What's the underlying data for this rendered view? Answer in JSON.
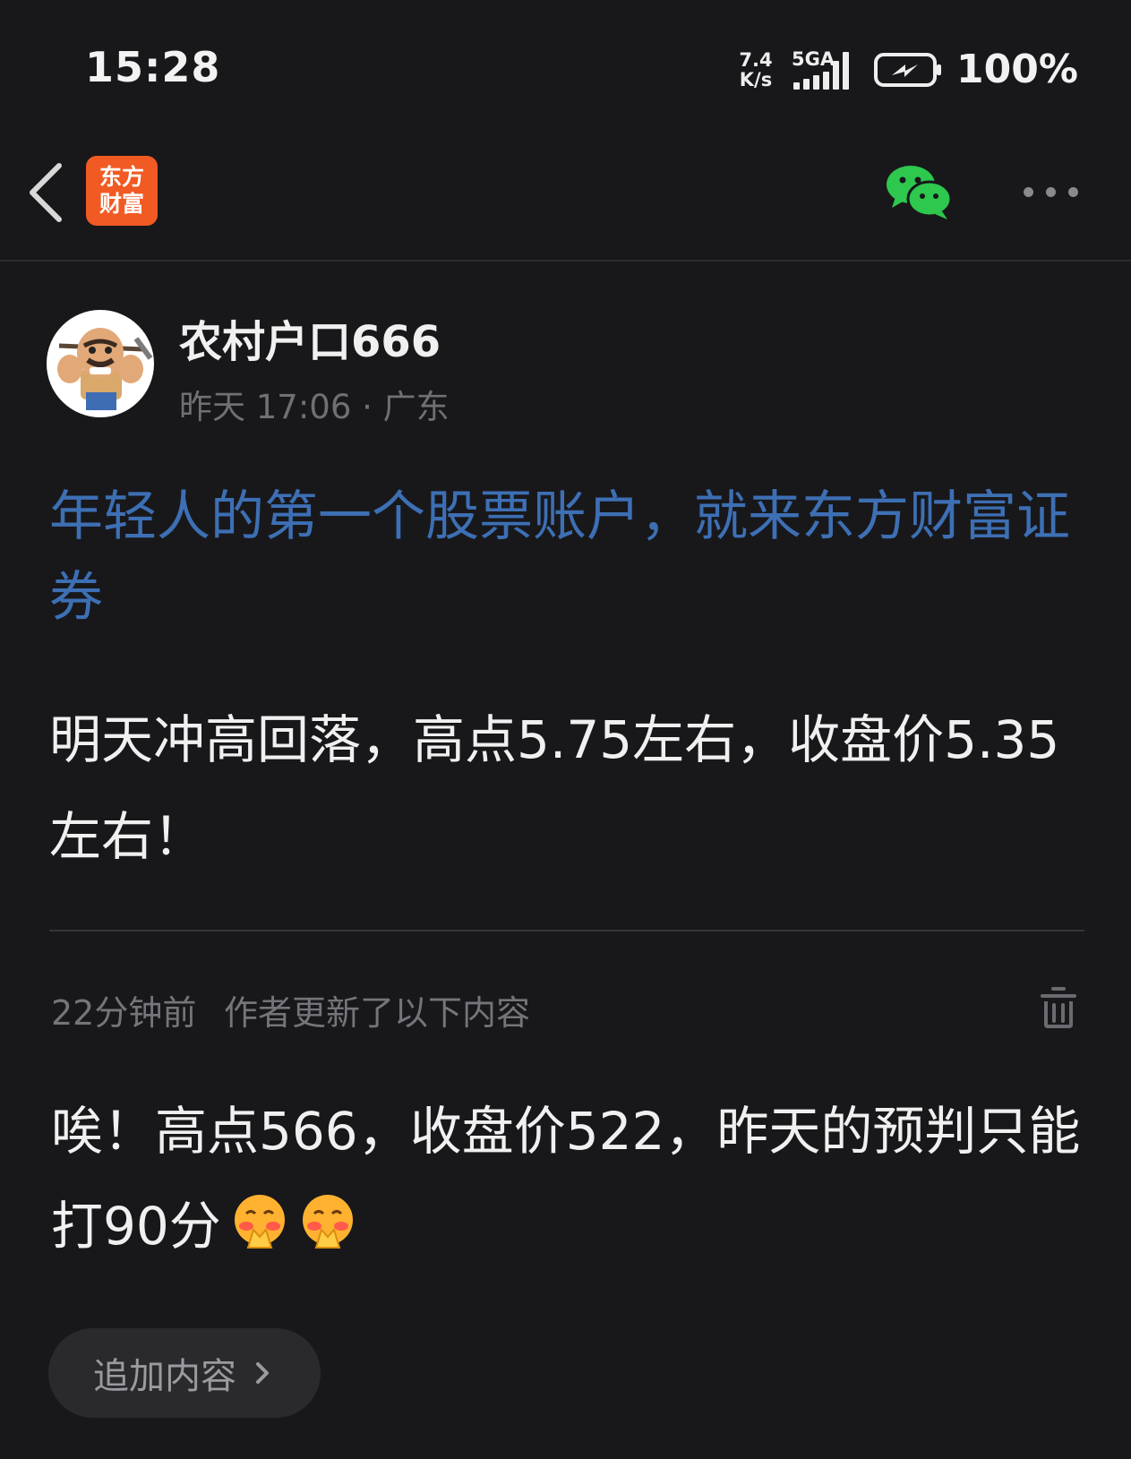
{
  "status_bar": {
    "time": "15:28",
    "net_speed_value": "7.4",
    "net_speed_unit": "K/s",
    "signal_label": "5GA",
    "battery_percent": "100%"
  },
  "header": {
    "logo_line1": "东方",
    "logo_line2": "财富",
    "icons": {
      "back": "chevron-left-icon",
      "share": "wechat-icon",
      "more": "more-dots-icon"
    }
  },
  "post": {
    "author_name": "农村户口666",
    "meta": "昨天 17:06 · 广东",
    "promo_link": "年轻人的第一个股票账户，就来东方财富证券",
    "body": "明天冲高回落，高点5.75左右，收盘价5.35左右！"
  },
  "update": {
    "time": "22分钟前",
    "note": "作者更新了以下内容",
    "text": "唉！高点566，收盘价522，昨天的预判只能打90分",
    "emoji_count": 2
  },
  "append_button": {
    "label": "追加内容"
  },
  "colors": {
    "background": "#18181b",
    "link": "#3d6fb4",
    "brand": "#f25a24",
    "wechat": "#2dc84d"
  }
}
